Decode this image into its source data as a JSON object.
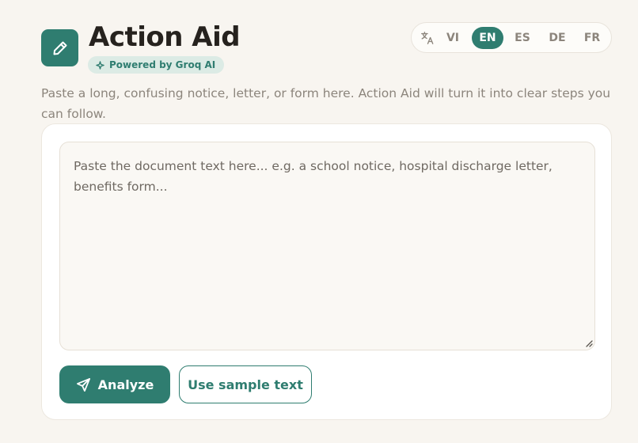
{
  "app": {
    "title": "Action Aid",
    "badge": "Powered by Groq AI",
    "logo_icon": "pencil-icon",
    "accent_color": "#2f7d70"
  },
  "language_switcher": {
    "icon": "translate-icon",
    "options": [
      "VI",
      "EN",
      "ES",
      "DE",
      "FR"
    ],
    "selected": "EN"
  },
  "intro_text": "Paste a long, confusing notice, letter, or form here. Action Aid will turn it into clear steps you can follow.",
  "document_input": {
    "value": "",
    "placeholder": "Paste the document text here... e.g. a school notice, hospital discharge letter, benefits form..."
  },
  "actions": {
    "analyze_label": "Analyze",
    "analyze_icon": "send-icon",
    "sample_label": "Use sample text"
  }
}
